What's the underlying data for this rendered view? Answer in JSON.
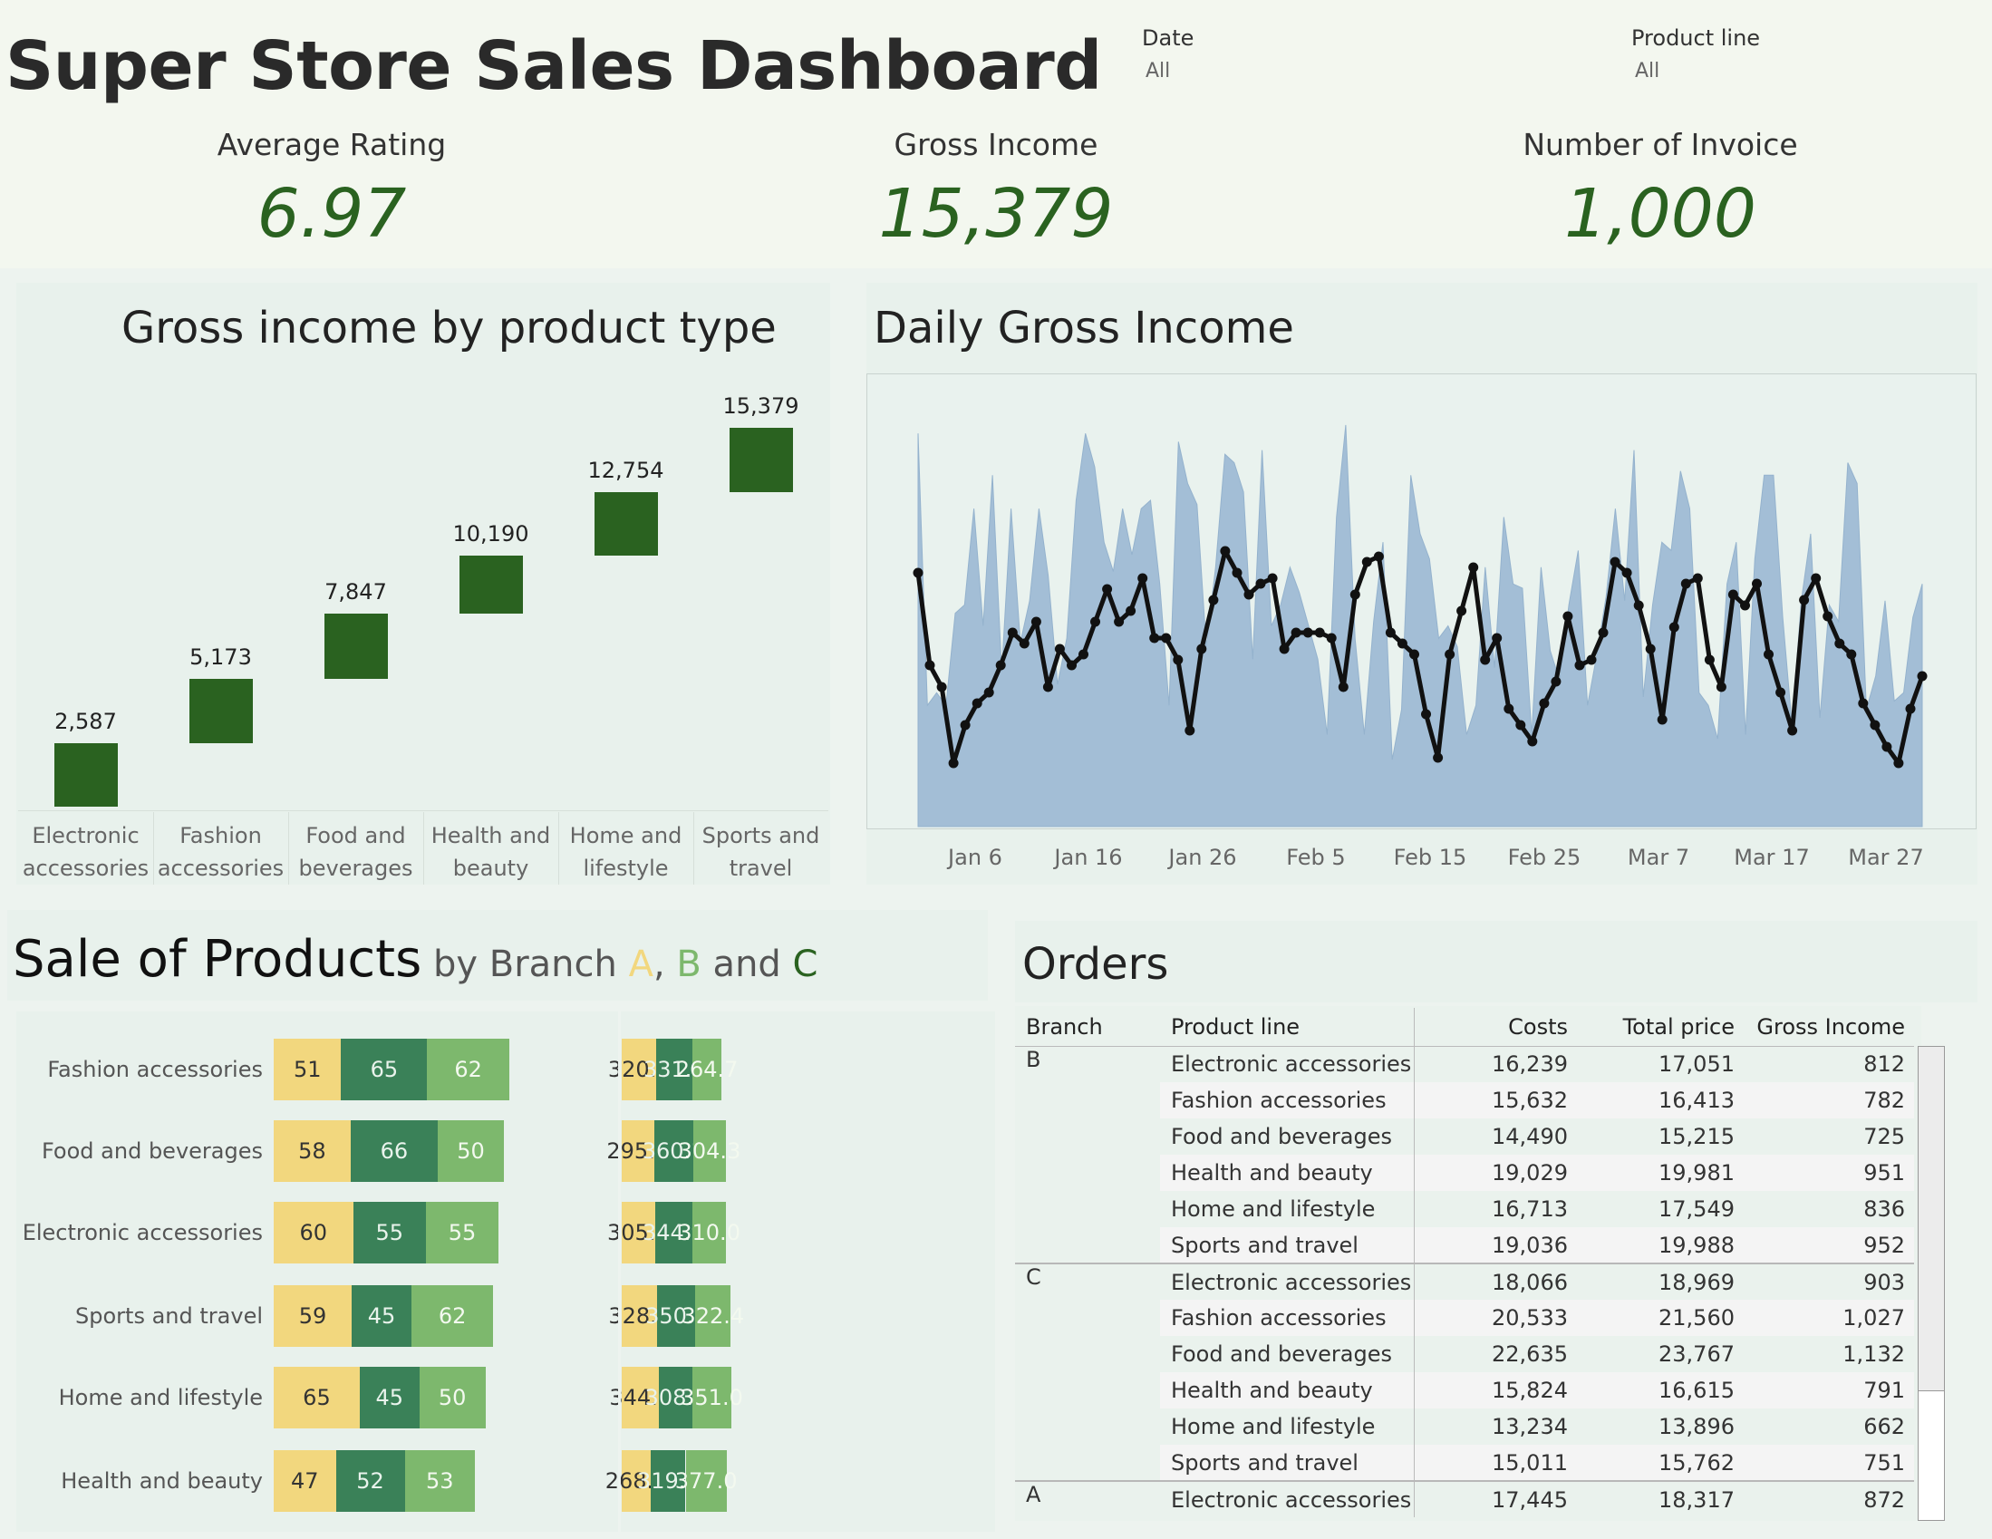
{
  "dashboard": {
    "title": "Super Store Sales Dashboard",
    "filters": [
      {
        "label": "Date",
        "value": "All"
      },
      {
        "label": "Product line",
        "value": "All"
      }
    ],
    "kpis": [
      {
        "label": "Average Rating",
        "value": "6.97"
      },
      {
        "label": "Gross Income",
        "value": "15,379"
      },
      {
        "label": "Number of Invoice",
        "value": "1,000"
      }
    ]
  },
  "colors": {
    "dark_green": "#2a6220",
    "branch_a": "#f2d77e",
    "branch_b": "#3a8158",
    "branch_c": "#7db86d",
    "area": "#a3bed6"
  },
  "waterfall": {
    "title": "Gross income by product type",
    "chart_data": {
      "type": "bar",
      "categories": [
        "Electronic accessories",
        "Fashion accessories",
        "Food and beverages",
        "Health and beauty",
        "Home and lifestyle",
        "Sports and travel"
      ],
      "labels": [
        "2,587",
        "5,173",
        "7,847",
        "10,190",
        "12,754",
        "15,379"
      ],
      "values": [
        2587,
        5173,
        7847,
        10190,
        12754,
        15379
      ],
      "category_lines": [
        [
          "Electronic",
          "accessories"
        ],
        [
          "Fashion",
          "accessories"
        ],
        [
          "Food and",
          "beverages"
        ],
        [
          "Health and",
          "beauty"
        ],
        [
          "Home and",
          "lifestyle"
        ],
        [
          "Sports and",
          "travel"
        ]
      ]
    }
  },
  "daily": {
    "title": "Daily Gross Income",
    "chart_data": {
      "type": "area",
      "x_ticks": [
        "Jan 6",
        "Jan 16",
        "Jan 26",
        "Feb 5",
        "Feb 15",
        "Feb 25",
        "Mar 7",
        "Mar 17",
        "Mar 27"
      ],
      "area_values": [
        470,
        145,
        160,
        145,
        255,
        265,
        380,
        240,
        420,
        185,
        380,
        220,
        270,
        380,
        300,
        170,
        225,
        390,
        470,
        430,
        340,
        305,
        380,
        325,
        380,
        390,
        290,
        145,
        460,
        410,
        385,
        215,
        310,
        445,
        435,
        400,
        200,
        450,
        240,
        265,
        310,
        280,
        240,
        200,
        110,
        370,
        480,
        225,
        110,
        245,
        340,
        80,
        140,
        420,
        350,
        320,
        225,
        240,
        215,
        110,
        145,
        310,
        190,
        370,
        290,
        285,
        110,
        310,
        210,
        175,
        265,
        330,
        145,
        205,
        275,
        380,
        270,
        450,
        155,
        265,
        340,
        330,
        425,
        380,
        160,
        145,
        105,
        290,
        340,
        110,
        320,
        420,
        420,
        250,
        120,
        270,
        350,
        130,
        265,
        245,
        435,
        410,
        140,
        180,
        270,
        150,
        160,
        250,
        290
      ],
      "line_values": [
        300,
        215,
        195,
        125,
        160,
        180,
        190,
        215,
        245,
        235,
        255,
        195,
        230,
        215,
        225,
        255,
        285,
        255,
        265,
        295,
        240,
        240,
        220,
        155,
        230,
        275,
        320,
        300,
        280,
        290,
        295,
        230,
        245,
        245,
        245,
        240,
        195,
        280,
        310,
        315,
        245,
        235,
        225,
        170,
        130,
        225,
        265,
        305,
        220,
        240,
        175,
        160,
        145,
        180,
        200,
        260,
        215,
        220,
        245,
        310,
        300,
        270,
        230,
        165,
        250,
        290,
        295,
        220,
        195,
        280,
        270,
        290,
        225,
        190,
        155,
        275,
        295,
        260,
        235,
        225,
        180,
        160,
        140,
        125,
        175,
        205
      ],
      "area_ymax": 520,
      "line_ymax": 400
    }
  },
  "sales": {
    "title_main": "Sale of Products",
    "title_pre": " by Branch ",
    "title_a": "A",
    "title_sep1": ", ",
    "title_b": "B",
    "title_sep2": " and ",
    "title_c": "C",
    "chart_data": {
      "type": "bar",
      "categories": [
        "Fashion accessories",
        "Food and beverages",
        "Electronic accessories",
        "Sports and travel",
        "Home and lifestyle",
        "Health and beauty"
      ],
      "series_count": [
        {
          "name": "A",
          "values": [
            51,
            58,
            60,
            59,
            65,
            47
          ]
        },
        {
          "name": "B",
          "values": [
            65,
            66,
            55,
            45,
            45,
            52
          ]
        },
        {
          "name": "C",
          "values": [
            62,
            50,
            55,
            62,
            50,
            53
          ]
        }
      ],
      "series_amount": [
        {
          "name": "A",
          "values": [
            320.2,
            295.9,
            305.3,
            328.4,
            344.9,
            268.0
          ]
        },
        {
          "name": "B",
          "values": [
            331.7,
            360.1,
            344.9,
            350.3,
            308.8,
            319.5
          ]
        },
        {
          "name": "C",
          "values": [
            264.7,
            304.3,
            310.0,
            322.4,
            351.0,
            377.0
          ]
        }
      ],
      "count_labels": [
        [
          "51",
          "65",
          "62"
        ],
        [
          "58",
          "66",
          "50"
        ],
        [
          "60",
          "55",
          "55"
        ],
        [
          "59",
          "45",
          "62"
        ],
        [
          "65",
          "45",
          "50"
        ],
        [
          "47",
          "52",
          "53"
        ]
      ],
      "amount_labels": [
        [
          "320.2",
          "331.7",
          "264.7"
        ],
        [
          "295.9",
          "360.1",
          "304.3"
        ],
        [
          "305.3",
          "344.9",
          "310.0"
        ],
        [
          "328.4",
          "350.3",
          "322.4"
        ],
        [
          "344.9",
          "308.8",
          "351.0"
        ],
        [
          "268.0",
          "319.5",
          "377.0"
        ]
      ]
    }
  },
  "orders": {
    "title": "Orders",
    "columns": [
      "Branch",
      "Product line",
      "Costs",
      "Total price",
      "Gross Income"
    ],
    "rows": [
      [
        "B",
        "Electronic accessories",
        "16,239",
        "17,051",
        "812"
      ],
      [
        "",
        "Fashion accessories",
        "15,632",
        "16,413",
        "782"
      ],
      [
        "",
        "Food and beverages",
        "14,490",
        "15,215",
        "725"
      ],
      [
        "",
        "Health and beauty",
        "19,029",
        "19,981",
        "951"
      ],
      [
        "",
        "Home and lifestyle",
        "16,713",
        "17,549",
        "836"
      ],
      [
        "",
        "Sports and travel",
        "19,036",
        "19,988",
        "952"
      ],
      [
        "C",
        "Electronic accessories",
        "18,066",
        "18,969",
        "903"
      ],
      [
        "",
        "Fashion accessories",
        "20,533",
        "21,560",
        "1,027"
      ],
      [
        "",
        "Food and beverages",
        "22,635",
        "23,767",
        "1,132"
      ],
      [
        "",
        "Health and beauty",
        "15,824",
        "16,615",
        "791"
      ],
      [
        "",
        "Home and lifestyle",
        "13,234",
        "13,896",
        "662"
      ],
      [
        "",
        "Sports and travel",
        "15,011",
        "15,762",
        "751"
      ],
      [
        "A",
        "Electronic accessories",
        "17,445",
        "18,317",
        "872"
      ]
    ]
  }
}
